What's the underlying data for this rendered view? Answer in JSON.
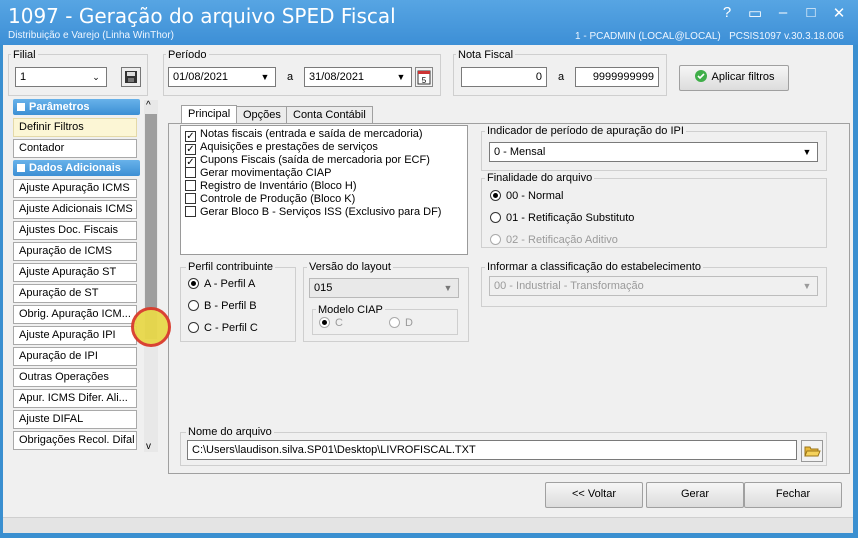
{
  "window": {
    "title": "1097 - Geração do arquivo SPED Fiscal",
    "subtitle": "Distribuição e Varejo (Linha WinThor)",
    "session": "1 - PCADMIN (LOCAL@LOCAL)",
    "version": "PCSIS1097  v.30.3.18.006",
    "buttons": [
      "?",
      "▭",
      "–",
      "□",
      "✕"
    ]
  },
  "filters": {
    "filial_label": "Filial",
    "filial_value": "1",
    "periodo_label": "Período",
    "date_from": "01/08/2021",
    "date_sep": "a",
    "date_to": "31/08/2021",
    "nota_label": "Nota Fiscal",
    "nota_from": "0",
    "nota_sep": "a",
    "nota_to": "9999999999",
    "apply_label": "Aplicar filtros"
  },
  "sidebar": {
    "parametros": "Parâmetros",
    "param_items": [
      "Definir Filtros",
      "Contador"
    ],
    "dados": "Dados Adicionais",
    "dados_items": [
      "Ajuste Apuração ICMS",
      "Ajuste Adicionais ICMS",
      "Ajustes Doc. Fiscais",
      "Apuração de ICMS",
      "Ajuste Apuração ST",
      "Apuração de ST",
      "Obrig. Apuração ICM...",
      "Ajuste Apuração IPI",
      "Apuração de IPI",
      "Outras Operações",
      "Apur. ICMS Difer. Ali...",
      "Ajuste DIFAL",
      "Obrigações Recol. Difal"
    ]
  },
  "tabs": [
    "Principal",
    "Opções",
    "Conta Contábil"
  ],
  "checks": [
    {
      "label": "Notas fiscais (entrada e saída de mercadoria)",
      "checked": true
    },
    {
      "label": "Aquisições e prestações de serviços",
      "checked": true
    },
    {
      "label": "Cupons Fiscais (saída de mercadoria por ECF)",
      "checked": true
    },
    {
      "label": "Gerar movimentação CIAP",
      "checked": false
    },
    {
      "label": "Registro de Inventário (Bloco H)",
      "checked": false
    },
    {
      "label": "Controle de Produção (Bloco K)",
      "checked": false
    },
    {
      "label": "Gerar Bloco B - Serviços ISS (Exclusivo para DF)",
      "checked": false
    }
  ],
  "ipi": {
    "label": "Indicador de período de apuração do IPI",
    "value": "0 - Mensal"
  },
  "finalidade": {
    "label": "Finalidade do arquivo",
    "options": [
      "00 - Normal",
      "01 - Retificação Substituto",
      "02 - Retificação Aditivo"
    ]
  },
  "perfil": {
    "label": "Perfil contribuinte",
    "options": [
      "A - Perfil A",
      "B - Perfil B",
      "C - Perfil C"
    ]
  },
  "layout": {
    "label": "Versão do layout",
    "value": "015"
  },
  "ciap": {
    "label": "Modelo CIAP",
    "options": [
      "C",
      "D"
    ]
  },
  "classificacao": {
    "label": "Informar a classificação do estabelecimento",
    "value": "00 - Industrial - Transformação"
  },
  "arquivo": {
    "label": "Nome do arquivo",
    "value": "C:\\Users\\laudison.silva.SP01\\Desktop\\LIVROFISCAL.TXT"
  },
  "footer": {
    "voltar": "<< Voltar",
    "gerar": "Gerar",
    "fechar": "Fechar"
  }
}
